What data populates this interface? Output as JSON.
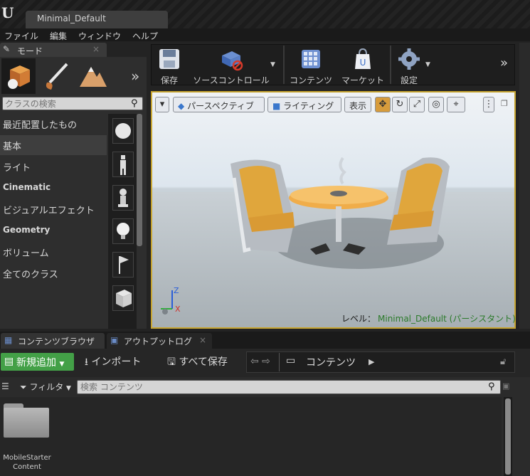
{
  "window": {
    "tab_title": "Minimal_Default"
  },
  "menu": [
    "ファイル",
    "編集",
    "ウィンドウ",
    "ヘルプ"
  ],
  "modes": {
    "tab_label": "モード",
    "close": "×",
    "more": "»",
    "search_placeholder": "クラスの検索",
    "categories": [
      "最近配置したもの",
      "基本",
      "ライト",
      "Cinematic",
      "ビジュアルエフェクト",
      "Geometry",
      "ボリューム",
      "全てのクラス"
    ],
    "selected_category": "基本"
  },
  "toolbar": {
    "save": "保存",
    "source_control": "ソースコントロール",
    "content": "コンテンツ",
    "market": "マーケット",
    "settings": "設定",
    "more": "»"
  },
  "viewport": {
    "perspective": "パースペクティブ",
    "lighting": "ライティング",
    "show": "表示",
    "status_prefix": "レベル：",
    "level": "Minimal_Default (パーシスタント)",
    "axis_z": "Z",
    "axis_x": "X"
  },
  "content_browser": {
    "tab_browser": "コンテンツブラウザ",
    "tab_output": "アウトプットログ",
    "close": "×",
    "add_new": "新規追加",
    "import": "インポート",
    "save_all": "すべて保存",
    "path": "コンテンツ",
    "filter": "フィルタ",
    "search_placeholder": "検索 コンテンツ",
    "folder_name_line1": "MobileStarter",
    "folder_name_line2": "Content"
  }
}
